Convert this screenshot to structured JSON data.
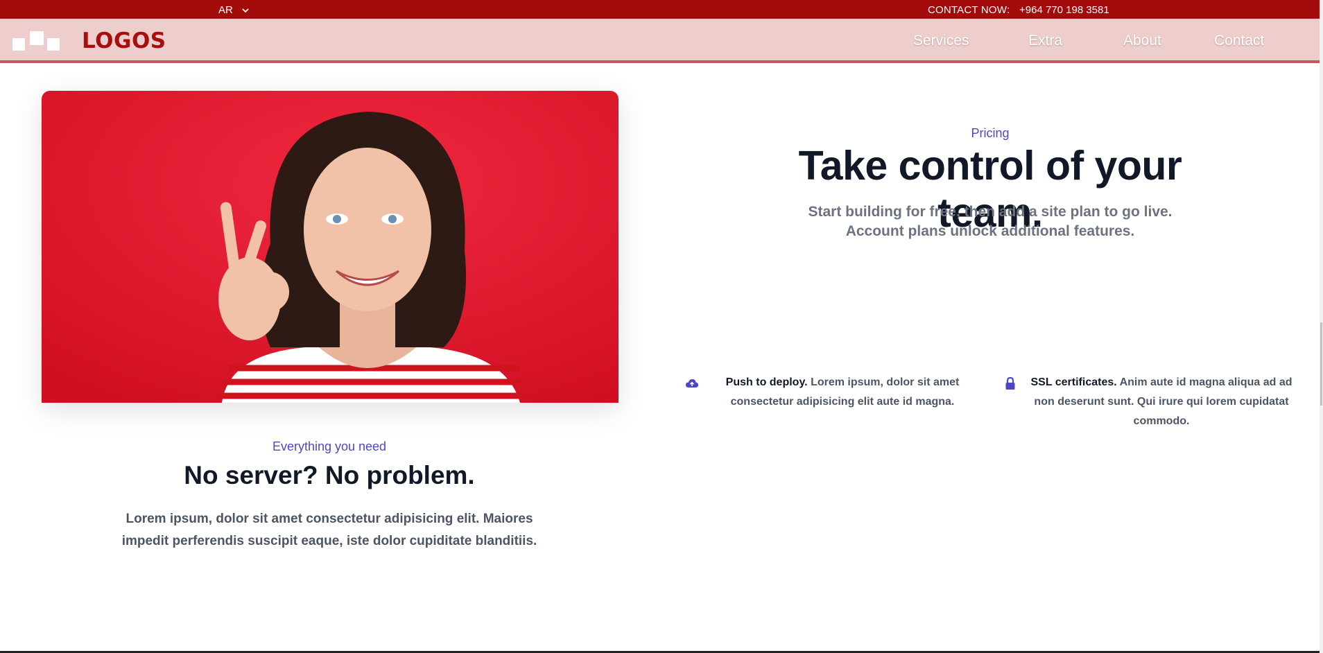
{
  "topbar": {
    "language": "AR",
    "contact_label": "CONTACT NOW:",
    "contact_phone": "+964 770 198 3581"
  },
  "header": {
    "logo_text": "LOGOS",
    "nav": [
      "Services",
      "Extra",
      "About",
      "Contact"
    ]
  },
  "hero": {
    "image": "woman-ok-gesture-red-background"
  },
  "pricing": {
    "label": "Pricing",
    "title": "Take control of your team.",
    "subtitle_line1": "Start building for free, then add a site plan to go live.",
    "subtitle_line2": "Account plans unlock additional features."
  },
  "features": [
    {
      "icon": "cloud-upload-icon",
      "title": "Push to deploy.",
      "text": "Lorem ipsum, dolor sit amet consectetur adipisicing elit aute id magna."
    },
    {
      "icon": "lock-icon",
      "title": "SSL certificates.",
      "text": "Anim aute id magna aliqua ad ad non deserunt sunt. Qui irure qui lorem cupidatat commodo."
    }
  ],
  "section2": {
    "label": "Everything you need",
    "title": "No server? No problem.",
    "body": "Lorem ipsum, dolor sit amet consectetur adipisicing elit. Maiores impedit perferendis suscipit eaque, iste dolor cupiditate blanditiis."
  },
  "colors": {
    "topbar": "#a30a0a",
    "header": "#eecdcd",
    "accent": "#4f46c5",
    "heading": "#111827"
  }
}
